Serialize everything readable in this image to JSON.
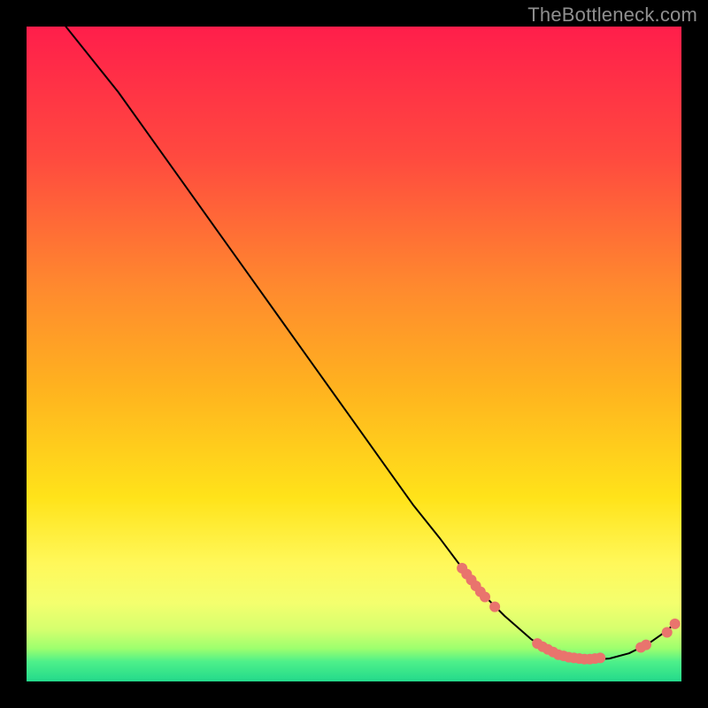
{
  "watermark": "TheBottleneck.com",
  "chart_data": {
    "type": "line",
    "title": "",
    "xlabel": "",
    "ylabel": "",
    "xlim": [
      0,
      100
    ],
    "ylim": [
      0,
      100
    ],
    "grid": false,
    "legend": false,
    "background_gradient_stops": [
      {
        "pct": 0,
        "color": "#ff1e4b"
      },
      {
        "pct": 20,
        "color": "#ff4a3f"
      },
      {
        "pct": 40,
        "color": "#ff8a2e"
      },
      {
        "pct": 55,
        "color": "#ffb21f"
      },
      {
        "pct": 72,
        "color": "#ffe31a"
      },
      {
        "pct": 82,
        "color": "#fff85a"
      },
      {
        "pct": 88,
        "color": "#f4ff6e"
      },
      {
        "pct": 92,
        "color": "#d6ff6e"
      },
      {
        "pct": 95,
        "color": "#9cff6e"
      },
      {
        "pct": 97,
        "color": "#4df08a"
      },
      {
        "pct": 100,
        "color": "#23d98b"
      }
    ],
    "curve": {
      "color": "#000000",
      "width": 2,
      "points_xy": [
        [
          6,
          100
        ],
        [
          10,
          95
        ],
        [
          14,
          90
        ],
        [
          19,
          83
        ],
        [
          24,
          76
        ],
        [
          29,
          69
        ],
        [
          34,
          62
        ],
        [
          39,
          55
        ],
        [
          44,
          48
        ],
        [
          49,
          41
        ],
        [
          54,
          34
        ],
        [
          59,
          27
        ],
        [
          63,
          22
        ],
        [
          66,
          18
        ],
        [
          70,
          13
        ],
        [
          73,
          10
        ],
        [
          77,
          6.5
        ],
        [
          80,
          4.5
        ],
        [
          83,
          3.5
        ],
        [
          86,
          3.3
        ],
        [
          89,
          3.5
        ],
        [
          92,
          4.3
        ],
        [
          95,
          5.8
        ],
        [
          97,
          7.2
        ],
        [
          99,
          8.8
        ]
      ]
    },
    "markers": {
      "color": "#e9746d",
      "radius": 6,
      "points_xy": [
        [
          66.5,
          17.3
        ],
        [
          67.2,
          16.4
        ],
        [
          67.9,
          15.5
        ],
        [
          68.6,
          14.6
        ],
        [
          69.3,
          13.7
        ],
        [
          70.0,
          12.9
        ],
        [
          71.5,
          11.4
        ],
        [
          78.0,
          5.8
        ],
        [
          78.8,
          5.3
        ],
        [
          79.6,
          4.9
        ],
        [
          80.4,
          4.5
        ],
        [
          81.2,
          4.1
        ],
        [
          82.0,
          3.9
        ],
        [
          82.8,
          3.7
        ],
        [
          83.6,
          3.6
        ],
        [
          84.4,
          3.5
        ],
        [
          85.2,
          3.4
        ],
        [
          86.0,
          3.4
        ],
        [
          86.8,
          3.5
        ],
        [
          87.6,
          3.6
        ],
        [
          93.8,
          5.2
        ],
        [
          94.6,
          5.6
        ],
        [
          97.8,
          7.5
        ],
        [
          99.0,
          8.8
        ]
      ]
    }
  }
}
